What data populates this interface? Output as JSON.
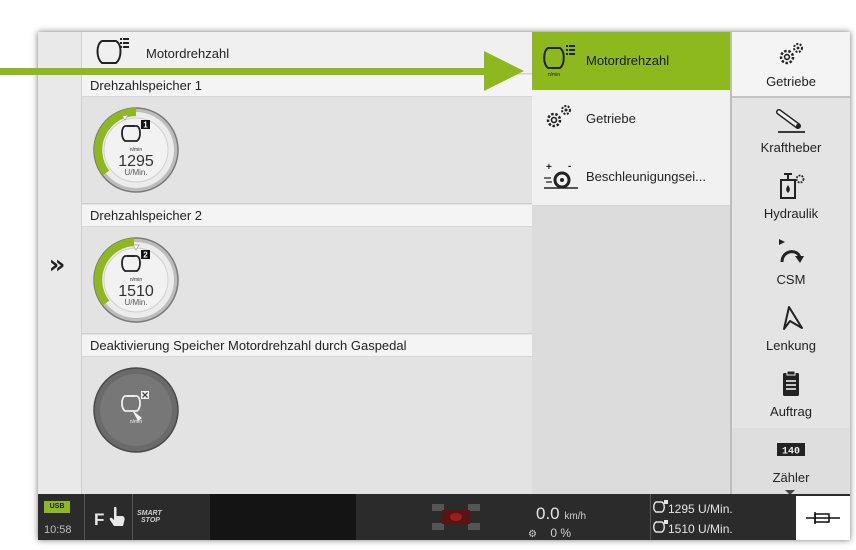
{
  "header": {
    "title": "Motordrehzahl",
    "icon": "engine-rpm-icon"
  },
  "sections": [
    {
      "title": "Drehzahlspeicher 1",
      "slot": "1",
      "unit_small": "n/min",
      "value": "1295",
      "unit": "U/Min."
    },
    {
      "title": "Drehzahlspeicher 2",
      "slot": "2",
      "unit_small": "n/min",
      "value": "1510",
      "unit": "U/Min."
    },
    {
      "title": "Deaktivierung Speicher Motordrehzahl durch Gaspedal",
      "unit_small": "n/min"
    }
  ],
  "menu": {
    "items": [
      {
        "label": "Motordrehzahl",
        "icon": "engine-rpm-icon",
        "active": true,
        "unit_small": "n/min"
      },
      {
        "label": "Getriebe",
        "icon": "gears-icon"
      },
      {
        "label": "Beschleunigungsei...",
        "icon": "acceleration-icon"
      }
    ]
  },
  "tabs": [
    {
      "label": "Getriebe",
      "icon": "gears-icon",
      "active": true
    },
    {
      "label": "Kraftheber",
      "icon": "hitch-icon"
    },
    {
      "label": "Hydraulik",
      "icon": "hydraulic-icon"
    },
    {
      "label": "CSM",
      "icon": "csm-icon"
    },
    {
      "label": "Lenkung",
      "icon": "steering-icon"
    },
    {
      "label": "Auftrag",
      "icon": "clipboard-icon"
    },
    {
      "label": "Zähler",
      "icon": "counter-icon",
      "counter_text": "140"
    }
  ],
  "statusbar": {
    "usb": "USB",
    "time": "10:58",
    "f_key": "F",
    "smart_stop_1": "SMART",
    "smart_stop_2": "STOP",
    "speed": "0.0",
    "speed_unit": "km/h",
    "slip": "0 %",
    "rpm1": "1295 U/Min.",
    "rpm2": "1510 U/Min."
  },
  "colors": {
    "accent": "#8eb91e",
    "statusbar": "#2b2b2b",
    "panel": "#e3e3e3"
  }
}
